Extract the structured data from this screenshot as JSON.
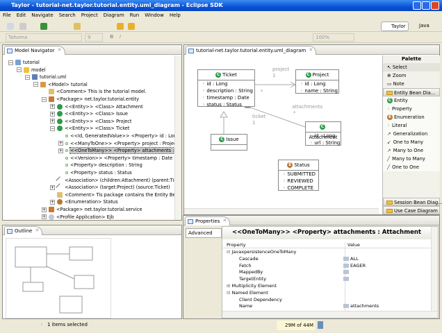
{
  "window": {
    "title": "Taylor - tutorial-net.taylor.tutorial.entity.uml_diagram - Eclipse SDK"
  },
  "menu": [
    "File",
    "Edit",
    "Navigate",
    "Search",
    "Project",
    "Diagram",
    "Run",
    "Window",
    "Help"
  ],
  "toolbar": {
    "font": "Tahoma",
    "size": "9",
    "bold": "B",
    "italic": "I",
    "zoom": "100%"
  },
  "perspectives": [
    "Taylor",
    "Java"
  ],
  "navigator": {
    "title": "Model Navigator",
    "items": [
      {
        "label": "tutorial",
        "depth": 0,
        "exp": "-",
        "icon": "project-icon"
      },
      {
        "label": "model",
        "depth": 1,
        "exp": "-",
        "icon": "folder-icon"
      },
      {
        "label": "tutorial.uml",
        "depth": 2,
        "exp": "-",
        "icon": "file-icon"
      },
      {
        "label": "<Model> tutorial",
        "depth": 3,
        "exp": "-",
        "icon": "model-icon"
      },
      {
        "label": "<Comment> This is the tutorial model.",
        "depth": 4,
        "exp": "",
        "icon": "comment-icon"
      },
      {
        "label": "<Package> net.taylor.tutorial.entity",
        "depth": 4,
        "exp": "-",
        "icon": "package-icon"
      },
      {
        "label": "<<Entity>> <Class> Attachment",
        "depth": 5,
        "exp": "+",
        "icon": "class-icon"
      },
      {
        "label": "<<Entity>> <Class> Issue",
        "depth": 5,
        "exp": "+",
        "icon": "class-icon"
      },
      {
        "label": "<<Entity>> <Class> Project",
        "depth": 5,
        "exp": "+",
        "icon": "class-icon"
      },
      {
        "label": "<<Entity>> <Class> Ticket",
        "depth": 5,
        "exp": "-",
        "icon": "class-icon"
      },
      {
        "label": "<<Id, GeneratedValue>> <Property> id : Long",
        "depth": 6,
        "exp": "",
        "icon": "property-icon"
      },
      {
        "label": "<<ManyToOne>> <Property> project : Project",
        "depth": 6,
        "exp": "+",
        "icon": "property-icon"
      },
      {
        "label": "<<OneToMany>> <Property> attachments : Attachment",
        "depth": 6,
        "exp": "+",
        "icon": "property-icon",
        "selected": true
      },
      {
        "label": "<<Version>> <Property> timestamp : Date",
        "depth": 6,
        "exp": "",
        "icon": "property-icon"
      },
      {
        "label": "<Property> description : String",
        "depth": 6,
        "exp": "",
        "icon": "property-icon"
      },
      {
        "label": "<Property> status : Status",
        "depth": 6,
        "exp": "",
        "icon": "property-icon"
      },
      {
        "label": "<Association> (children:Attachment) (parent:Ticket)",
        "depth": 5,
        "exp": "",
        "icon": "association-icon"
      },
      {
        "label": "<Association> (target:Project) (source:Ticket)",
        "depth": 5,
        "exp": "+",
        "icon": "association-icon"
      },
      {
        "label": "<Comment> Tis package contains the Entity Beans.",
        "depth": 5,
        "exp": "",
        "icon": "comment-icon"
      },
      {
        "label": "<Enumeration> Status",
        "depth": 5,
        "exp": "+",
        "icon": "enum-icon"
      },
      {
        "label": "<Package> net.taylor.tutorial.service",
        "depth": 4,
        "exp": "+",
        "icon": "package-icon"
      },
      {
        "label": "<Profile Application> Ejb",
        "depth": 4,
        "exp": "+",
        "icon": "profile-icon"
      }
    ]
  },
  "outline": {
    "title": "Outline"
  },
  "editor": {
    "tab": "tutorial-net.taylor.tutorial.entity.uml_diagram",
    "classes": {
      "ticket": {
        "name": "Ticket",
        "attrs": [
          "id : Long",
          "description : String",
          "timestamp : Date",
          "status : Status"
        ]
      },
      "project": {
        "name": "Project",
        "attrs": [
          "id : Long",
          "name : String"
        ]
      },
      "attachment": {
        "name": "Attachment",
        "attrs": [
          "id : Long",
          "url : String"
        ]
      },
      "issue": {
        "name": "Issue",
        "attrs": []
      },
      "status": {
        "name": "Status",
        "attrs": [
          "SUBMITTED",
          "REVIEWED",
          "COMPLETE"
        ]
      }
    },
    "labels": {
      "project": "project",
      "project_mult": "1",
      "star1": "*",
      "attachments": "attachments",
      "star2": "*",
      "ticket": "ticket",
      "ticket_mult": "1"
    }
  },
  "palette": {
    "title": "Palette",
    "tools": [
      "Select",
      "Zoom",
      "Note"
    ],
    "drawer": "Entity Bean Dia...",
    "items": [
      "Entity",
      "Property",
      "Enumeration",
      "Literal",
      "Generalization",
      "One to Many",
      "Many to One",
      "Many to Many",
      "One to One"
    ],
    "drawers_bottom": [
      "Session Bean Diag...",
      "Use Case Diagram"
    ]
  },
  "properties": {
    "title": "Properties",
    "side_tab": "Advanced",
    "heading": "<<OneToMany>> <Property> attachments : Attachment",
    "col_property": "Property",
    "col_value": "Value",
    "rows": [
      {
        "p": "JavaxpersistenceOneToMany",
        "v": "",
        "exp": "-",
        "indent": 0,
        "icon": false
      },
      {
        "p": "Cascade",
        "v": "ALL",
        "exp": "",
        "indent": 1,
        "icon": true
      },
      {
        "p": "Fetch",
        "v": "EAGER",
        "exp": "",
        "indent": 1,
        "icon": true
      },
      {
        "p": "MappedBy",
        "v": "",
        "exp": "",
        "indent": 1,
        "icon": true
      },
      {
        "p": "TargetEntity",
        "v": "",
        "exp": "",
        "indent": 1,
        "icon": true
      },
      {
        "p": "Multiplicity Element",
        "v": "",
        "exp": "+",
        "indent": 0,
        "icon": false
      },
      {
        "p": "Named Element",
        "v": "",
        "exp": "-",
        "indent": 0,
        "icon": false
      },
      {
        "p": "Client Dependency",
        "v": "",
        "exp": "",
        "indent": 1,
        "icon": false
      },
      {
        "p": "Name",
        "v": "attachments",
        "exp": "",
        "indent": 1,
        "icon": true
      }
    ]
  },
  "status": {
    "selection": "1 items selected",
    "heap": "29M of 44M"
  }
}
